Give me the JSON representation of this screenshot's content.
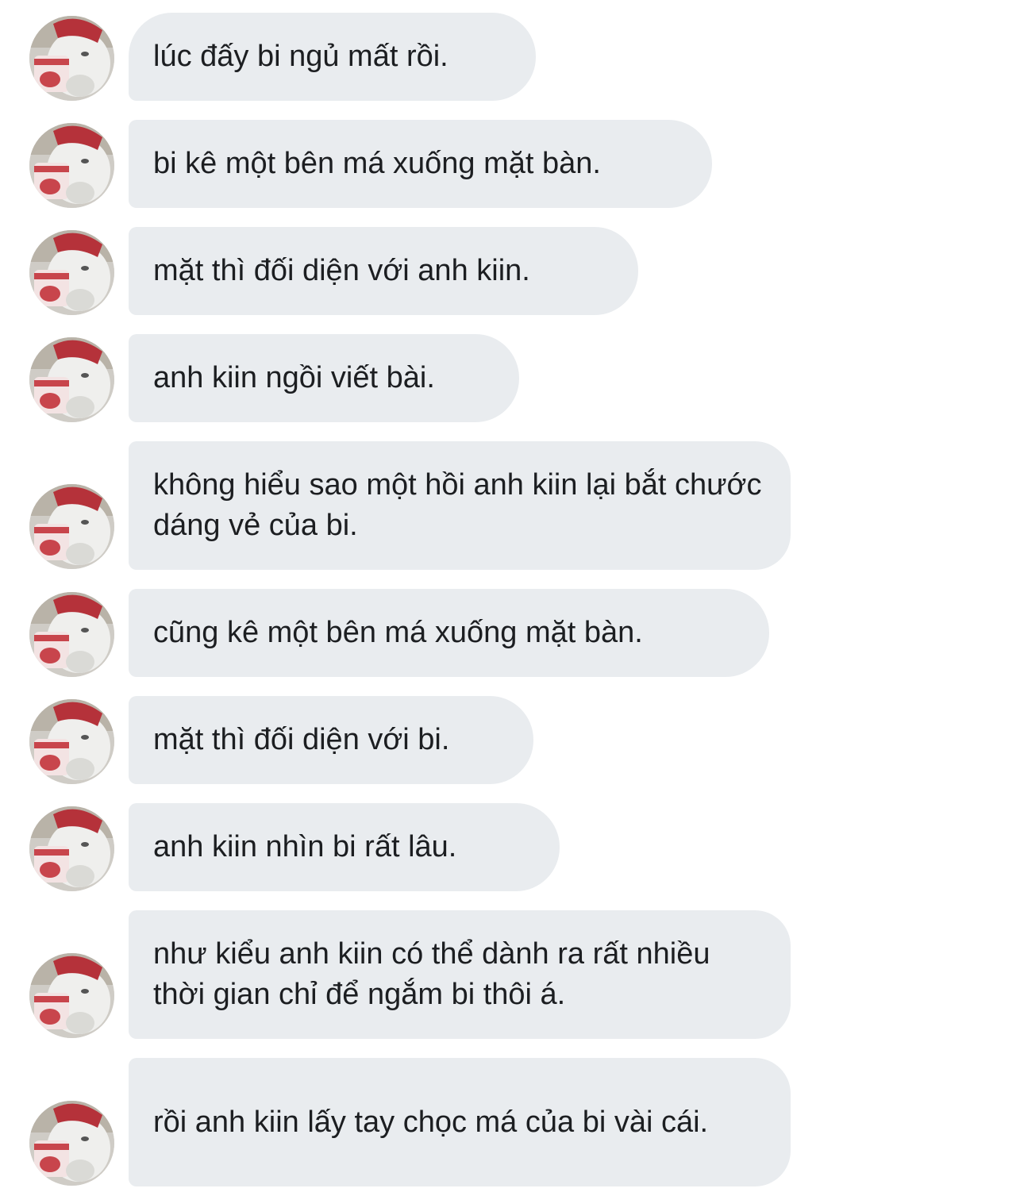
{
  "sender": {
    "avatar_icon": "bear-with-ice-cream-avatar",
    "avatar_bg": "#d8d6d2"
  },
  "bubble_color": "#e9ecef",
  "text_color": "#1c1e21",
  "messages": [
    {
      "text": "lúc đấy bi ngủ mất rồi."
    },
    {
      "text": "bi kê một bên má xuống mặt bàn."
    },
    {
      "text": "mặt thì đối diện với anh kiin."
    },
    {
      "text": "anh kiin ngồi viết bài."
    },
    {
      "text": "không hiểu sao một hồi anh kiin lại bắt chước dáng vẻ của bi."
    },
    {
      "text": "cũng kê một bên má xuống mặt bàn."
    },
    {
      "text": "mặt thì đối diện với bi."
    },
    {
      "text": "anh kiin nhìn bi rất lâu."
    },
    {
      "text": "như kiểu anh kiin có thể dành ra rất nhiều thời gian chỉ để ngắm bi thôi á."
    },
    {
      "text": "rồi anh kiin lấy tay chọc má của bi vài cái."
    }
  ]
}
